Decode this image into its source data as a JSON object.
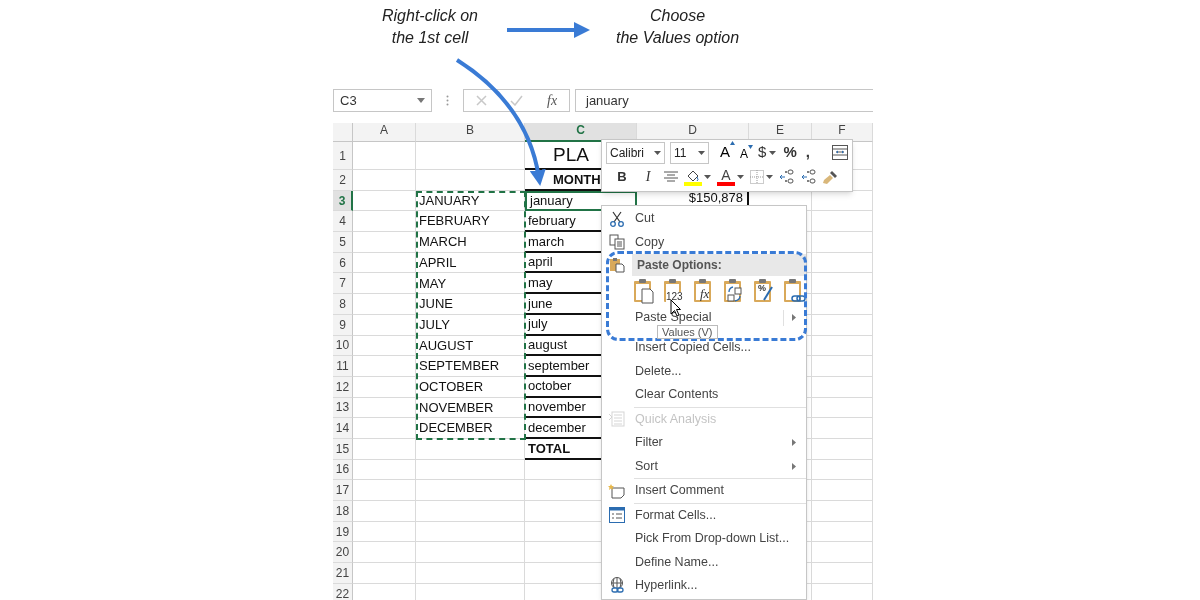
{
  "notes": [
    {
      "text": "Right-click on\nthe 1st cell"
    },
    {
      "text": "Choose\nthe Values option"
    }
  ],
  "formula_bar": {
    "name_box": "C3",
    "fx": "fx",
    "value": "january"
  },
  "columns": [
    {
      "label": "A",
      "selected": false
    },
    {
      "label": "B",
      "selected": false
    },
    {
      "label": "C",
      "selected": true
    },
    {
      "label": "D",
      "selected": false
    },
    {
      "label": "E",
      "selected": false
    },
    {
      "label": "F",
      "selected": false
    }
  ],
  "rows": [
    {
      "header": "1",
      "selected": false,
      "kind": "title",
      "C": "PLA"
    },
    {
      "header": "2",
      "selected": false,
      "kind": "heading",
      "C": "MONTH"
    },
    {
      "header": "3",
      "selected": true,
      "kind": "data",
      "B": "JANUARY",
      "C": "january",
      "D": "$150,878"
    },
    {
      "header": "4",
      "selected": false,
      "kind": "data",
      "B": "FEBRUARY",
      "C": "february"
    },
    {
      "header": "5",
      "selected": false,
      "kind": "data",
      "B": "MARCH",
      "C": "march"
    },
    {
      "header": "6",
      "selected": false,
      "kind": "data",
      "B": "APRIL",
      "C": "april"
    },
    {
      "header": "7",
      "selected": false,
      "kind": "data",
      "B": "MAY",
      "C": "may"
    },
    {
      "header": "8",
      "selected": false,
      "kind": "data",
      "B": "JUNE",
      "C": "june"
    },
    {
      "header": "9",
      "selected": false,
      "kind": "data",
      "B": "JULY",
      "C": "july"
    },
    {
      "header": "10",
      "selected": false,
      "kind": "data",
      "B": "AUGUST",
      "C": "august"
    },
    {
      "header": "11",
      "selected": false,
      "kind": "data",
      "B": "SEPTEMBER",
      "C": "september"
    },
    {
      "header": "12",
      "selected": false,
      "kind": "data",
      "B": "OCTOBER",
      "C": "october"
    },
    {
      "header": "13",
      "selected": false,
      "kind": "data",
      "B": "NOVEMBER",
      "C": "november"
    },
    {
      "header": "14",
      "selected": false,
      "kind": "data",
      "B": "DECEMBER",
      "C": "december"
    },
    {
      "header": "15",
      "selected": false,
      "kind": "total",
      "C": "TOTAL"
    },
    {
      "header": "16",
      "selected": false,
      "kind": "blank"
    },
    {
      "header": "17",
      "selected": false,
      "kind": "blank"
    },
    {
      "header": "18",
      "selected": false,
      "kind": "blank"
    },
    {
      "header": "19",
      "selected": false,
      "kind": "blank"
    },
    {
      "header": "20",
      "selected": false,
      "kind": "blank"
    },
    {
      "header": "21",
      "selected": false,
      "kind": "blank"
    },
    {
      "header": "22",
      "selected": false,
      "kind": "blank"
    }
  ],
  "mini_toolbar": {
    "row_1": [
      {
        "kind": "font",
        "label": "Calibri"
      },
      {
        "kind": "size",
        "label": "11"
      },
      {
        "kind": "grow",
        "label": "A"
      },
      {
        "kind": "shrink",
        "label": "A"
      },
      {
        "kind": "currency",
        "label": "$"
      },
      {
        "kind": "percent",
        "label": "%"
      },
      {
        "kind": "comma",
        "label": ","
      },
      {
        "kind": "wrap"
      }
    ],
    "row_2": [
      {
        "kind": "bold",
        "label": "B"
      },
      {
        "kind": "italic",
        "label": "I"
      },
      {
        "kind": "align"
      },
      {
        "kind": "fill",
        "color": "#ffff00"
      },
      {
        "kind": "fontcolor",
        "label": "A",
        "color": "#ff0000"
      },
      {
        "kind": "borders"
      },
      {
        "kind": "incdec"
      },
      {
        "kind": "decdec"
      },
      {
        "kind": "painter"
      }
    ]
  },
  "context_menu": {
    "items": [
      {
        "kind": "cut",
        "label": "Cut",
        "disabled": false,
        "submenu": false
      },
      {
        "kind": "copy",
        "label": "Copy",
        "disabled": false,
        "submenu": false
      },
      {
        "kind": "header",
        "label": "Paste Options:"
      },
      {
        "kind": "options",
        "options": [
          {
            "kind": "all"
          },
          {
            "kind": "values",
            "glyph": "123"
          },
          {
            "kind": "formulas",
            "glyph": "fx"
          },
          {
            "kind": "transpose"
          },
          {
            "kind": "formatting",
            "glyph": "%"
          },
          {
            "kind": "link"
          }
        ]
      },
      {
        "kind": "plain",
        "label": "Paste Special",
        "disabled": false,
        "submenu": true
      },
      {
        "kind": "plain",
        "label": "Insert Copied Cells...",
        "disabled": false,
        "submenu": false
      },
      {
        "kind": "plain",
        "label": "Delete...",
        "disabled": false,
        "submenu": false
      },
      {
        "kind": "plain",
        "label": "Clear Contents",
        "disabled": false,
        "submenu": false
      },
      {
        "kind": "separator"
      },
      {
        "kind": "analysis",
        "label": "Quick Analysis",
        "disabled": true,
        "submenu": false
      },
      {
        "kind": "plain",
        "label": "Filter",
        "disabled": false,
        "submenu": true
      },
      {
        "kind": "plain",
        "label": "Sort",
        "disabled": false,
        "submenu": true
      },
      {
        "kind": "separator"
      },
      {
        "kind": "comment",
        "label": "Insert Comment",
        "disabled": false,
        "submenu": false
      },
      {
        "kind": "separator"
      },
      {
        "kind": "format",
        "label": "Format Cells...",
        "disabled": false,
        "submenu": false
      },
      {
        "kind": "plain",
        "label": "Pick From Drop-down List...",
        "disabled": false,
        "submenu": false
      },
      {
        "kind": "plain",
        "label": "Define Name...",
        "disabled": false,
        "submenu": false
      },
      {
        "kind": "link",
        "label": "Hyperlink...",
        "disabled": false,
        "submenu": false
      }
    ]
  },
  "tooltip": "Values (V)"
}
